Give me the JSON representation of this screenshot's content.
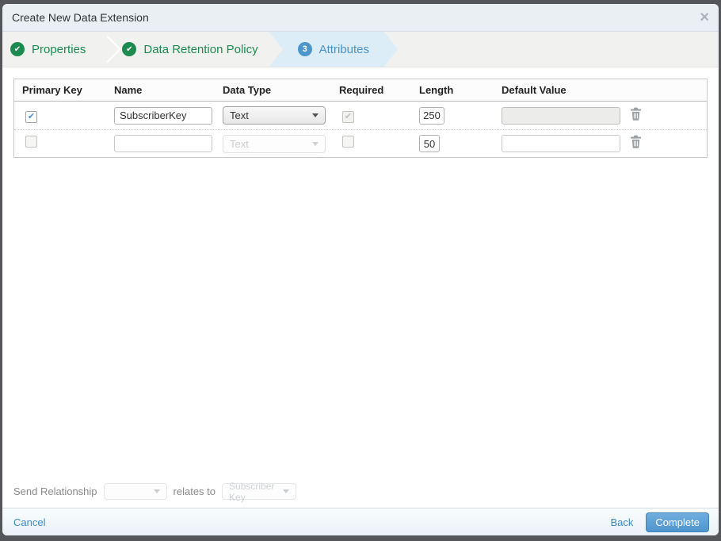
{
  "window": {
    "title": "Create New Data Extension",
    "close_glyph": "×"
  },
  "wizard": {
    "check_glyph": "✔",
    "steps": [
      {
        "label": "Properties",
        "state": "complete"
      },
      {
        "label": "Data Retention Policy",
        "state": "complete"
      },
      {
        "label": "Attributes",
        "state": "active",
        "number": "3"
      }
    ]
  },
  "table": {
    "headers": {
      "primary_key": "Primary Key",
      "name": "Name",
      "data_type": "Data Type",
      "required": "Required",
      "length": "Length",
      "default_value": "Default Value"
    },
    "check_glyph": "✔",
    "rows": [
      {
        "primary_key_checked": true,
        "name": "SubscriberKey",
        "data_type": "Text",
        "data_type_disabled": false,
        "required_checked": true,
        "required_disabled": true,
        "length": "250",
        "default_value": "",
        "default_value_disabled": true
      },
      {
        "primary_key_checked": false,
        "name": "",
        "data_type": "Text",
        "data_type_disabled": true,
        "required_checked": false,
        "required_disabled": false,
        "length": "50",
        "default_value": "",
        "default_value_disabled": false
      }
    ]
  },
  "send_relationship": {
    "label": "Send Relationship",
    "relates_to": "relates to",
    "target_field": "Subscriber Key"
  },
  "footer": {
    "cancel": "Cancel",
    "back": "Back",
    "complete": "Complete"
  },
  "colors": {
    "step_complete_green": "#1d8b4f",
    "step_active_blue": "#4a92c8",
    "step_active_bg": "#ddedf7",
    "link_blue": "#3d8bc4",
    "button_blue_top": "#70aedd",
    "button_blue_bottom": "#4e95cf",
    "titlebar_bg": "#e9eff3",
    "wizard_bg": "#f1f1ef",
    "checkbox_check_blue": "#4a90d2",
    "frame_gray": "#54565a"
  }
}
